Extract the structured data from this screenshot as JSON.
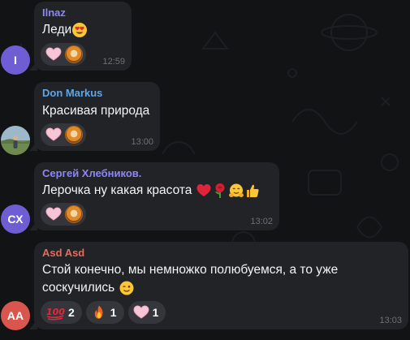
{
  "colors": {
    "background": "#111315",
    "bubble": "#212327",
    "reaction_pill": "#34363c",
    "timestamp": "#6d7075",
    "text": "#f4f4f5"
  },
  "messages": [
    {
      "sender": "Ilnaz",
      "sender_color": "#8e86f5",
      "avatar": {
        "type": "initials",
        "initials": "I",
        "color": "#6f5ed3"
      },
      "text_lines": [
        "Леди"
      ],
      "trailing_emoji": [
        "heart-eyes-emoji"
      ],
      "reactions": [
        {
          "icon": "pink-heart-icon",
          "reactor_avatar": "reactor-avatar"
        }
      ],
      "time": "12:59"
    },
    {
      "sender": "Don Markus",
      "sender_color": "#5ea6e8",
      "avatar": {
        "type": "photo",
        "initials": ""
      },
      "text_lines": [
        "Красивая природа"
      ],
      "trailing_emoji": [],
      "reactions": [
        {
          "icon": "pink-heart-icon",
          "reactor_avatar": "reactor-avatar"
        }
      ],
      "time": "13:00"
    },
    {
      "sender": "Сергей Хлебников.",
      "sender_color": "#8e86f5",
      "avatar": {
        "type": "initials",
        "initials": "СХ",
        "color": "#6f5ed3"
      },
      "text_lines": [
        "Лерочка ну какая красота"
      ],
      "trailing_emoji": [
        "red-heart-emoji",
        "rose-emoji",
        "hugging-face-emoji",
        "thumbs-up-emoji"
      ],
      "reactions": [
        {
          "icon": "pink-heart-icon",
          "reactor_avatar": "reactor-avatar"
        }
      ],
      "time": "13:02"
    },
    {
      "sender": "Asd Asd",
      "sender_color": "#e86a5e",
      "avatar": {
        "type": "initials",
        "initials": "AA",
        "color": "#d9564f"
      },
      "text_lines": [
        "Стой конечно, мы немножко полюбуемся, а то уже",
        "соскучились"
      ],
      "trailing_emoji": [
        "winking-face-emoji"
      ],
      "reactions": [
        {
          "icon": "hundred-points-icon",
          "count": "2"
        },
        {
          "icon": "fire-icon",
          "count": "1"
        },
        {
          "icon": "pink-heart-icon",
          "count": "1"
        }
      ],
      "time": "13:03"
    }
  ]
}
